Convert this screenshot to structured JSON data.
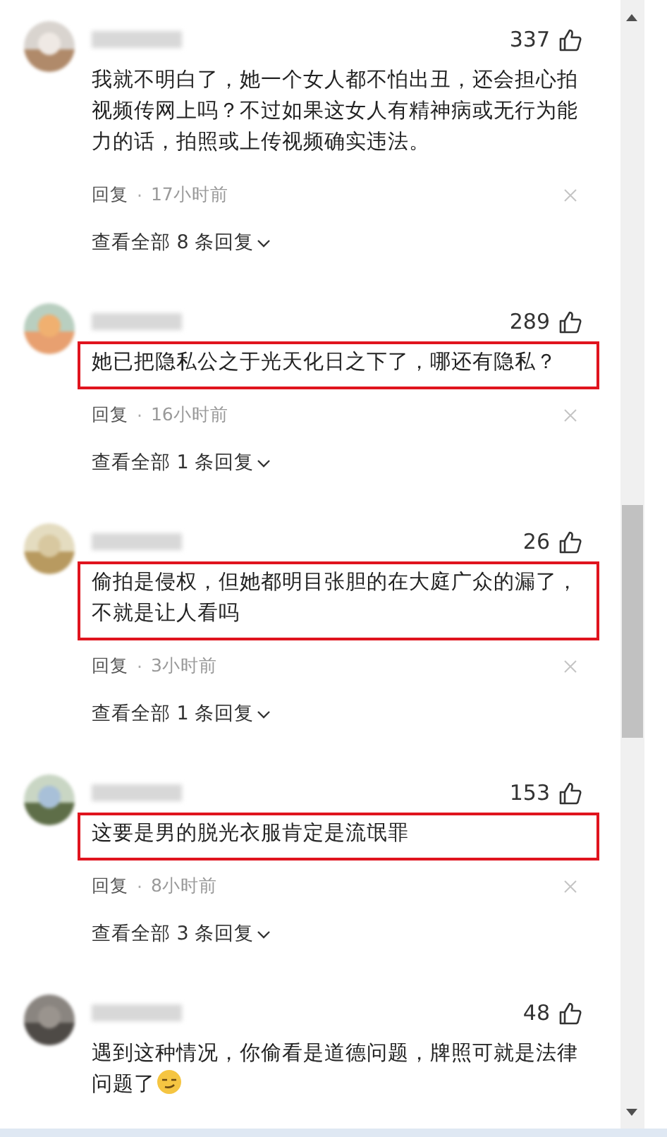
{
  "comments": [
    {
      "likes": "337",
      "text": "我就不明白了，她一个女人都不怕出丑，还会担心拍视频传网上吗？不过如果这女人有精神病或无行为能力的话，拍照或上传视频确实违法。",
      "highlighted": false,
      "reply": "回复",
      "separator": "·",
      "time": "17小时前",
      "view_replies": "查看全部 8 条回复"
    },
    {
      "likes": "289",
      "text": "她已把隐私公之于光天化日之下了，哪还有隐私？",
      "highlighted": true,
      "reply": "回复",
      "separator": "·",
      "time": "16小时前",
      "view_replies": "查看全部 1 条回复"
    },
    {
      "likes": "26",
      "text": "偷拍是侵权，但她都明目张胆的在大庭广众的漏了，不就是让人看吗",
      "highlighted": true,
      "reply": "回复",
      "separator": "·",
      "time": "3小时前",
      "view_replies": "查看全部 1 条回复"
    },
    {
      "likes": "153",
      "text": "这要是男的脱光衣服肯定是流氓罪",
      "highlighted": true,
      "reply": "回复",
      "separator": "·",
      "time": "8小时前",
      "view_replies": "查看全部 3 条回复"
    },
    {
      "likes": "48",
      "text": "遇到这种情况，你偷看是道德问题，牌照可就是法律问题了",
      "highlighted": false,
      "emoji": true
    }
  ]
}
